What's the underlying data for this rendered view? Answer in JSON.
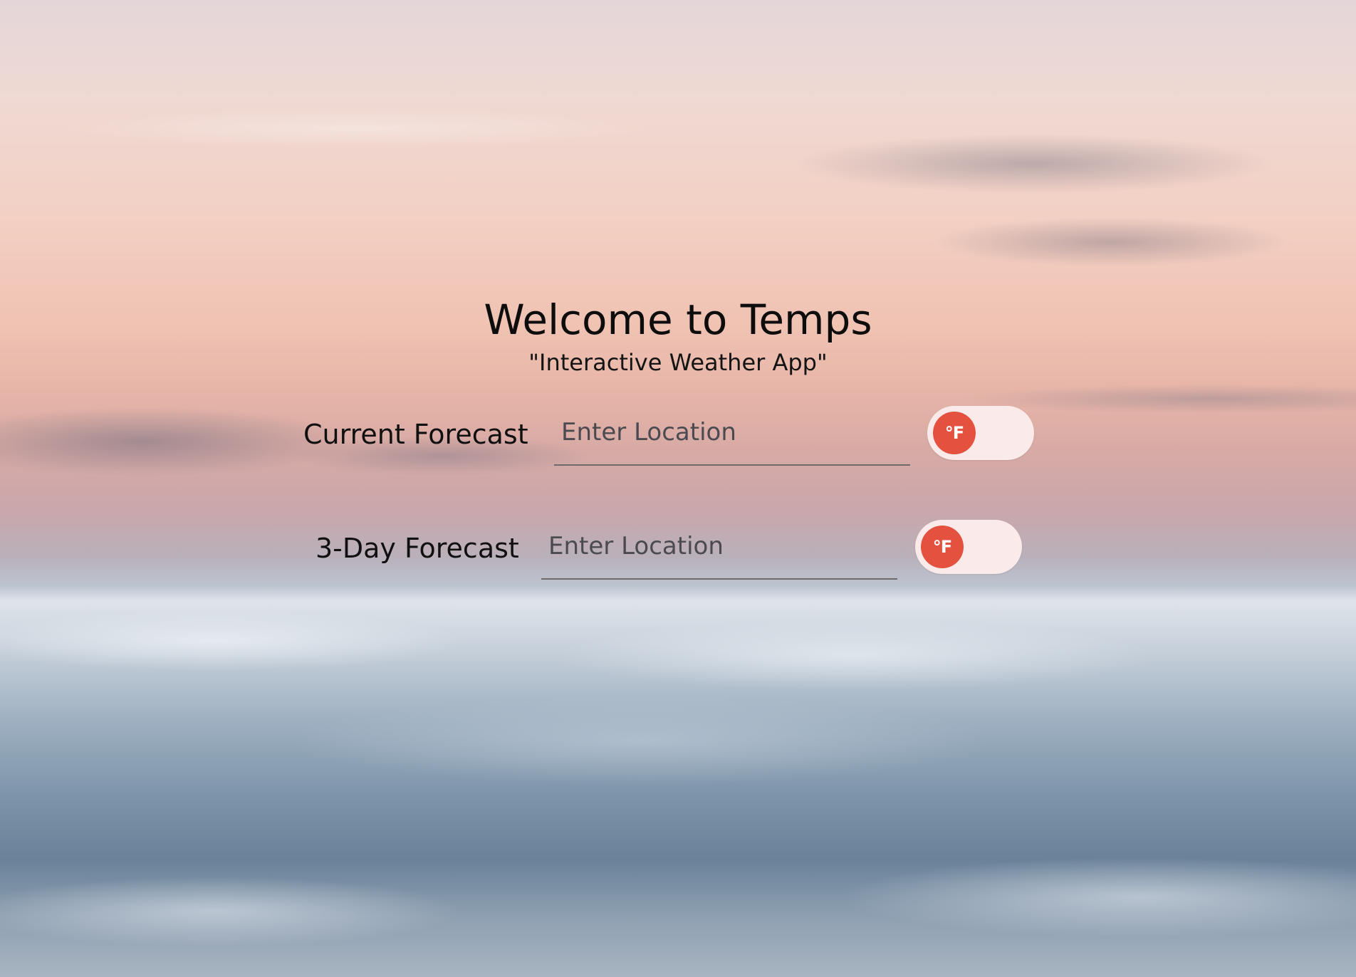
{
  "app": {
    "title": "Welcome to Temps",
    "subtitle": "\"Interactive Weather App\""
  },
  "forecasts": [
    {
      "label": "Current Forecast",
      "input": {
        "value": "",
        "placeholder": "Enter Location"
      },
      "unit_toggle": {
        "unit_label": "°F",
        "state": "off"
      }
    },
    {
      "label": "3-Day Forecast",
      "input": {
        "value": "",
        "placeholder": "Enter Location"
      },
      "unit_toggle": {
        "unit_label": "°F",
        "state": "off"
      }
    }
  ],
  "theme": {
    "accent": "#e4523f",
    "toggle_track": "#fbeaea",
    "underline": "#6d6a6e"
  },
  "icons": {
    "background": "sky-above-clouds-photo"
  }
}
